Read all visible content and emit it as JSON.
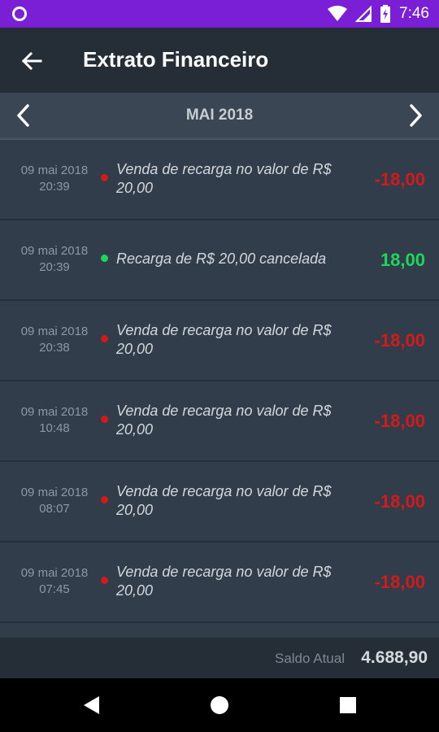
{
  "status_bar": {
    "time": "7:46",
    "icons": [
      "circle-notification-icon",
      "wifi-icon",
      "signal-icon",
      "battery-charging-icon"
    ],
    "color": "#7b1fd6"
  },
  "app_bar": {
    "title": "Extrato Financeiro",
    "back_icon": "arrow-left-icon"
  },
  "month_selector": {
    "label": "MAI 2018",
    "prev_icon": "chevron-left-icon",
    "next_icon": "chevron-right-icon"
  },
  "transactions": [
    {
      "date": "09 mai 2018",
      "time": "20:39",
      "description": "Venda de recarga no valor de R$ 20,00",
      "amount": "-18,00",
      "type": "debit"
    },
    {
      "date": "09 mai 2018",
      "time": "20:39",
      "description": "Recarga de R$ 20,00 cancelada",
      "amount": "18,00",
      "type": "credit"
    },
    {
      "date": "09 mai 2018",
      "time": "20:38",
      "description": "Venda de recarga no valor de R$ 20,00",
      "amount": "-18,00",
      "type": "debit"
    },
    {
      "date": "09 mai 2018",
      "time": "10:48",
      "description": "Venda de recarga no valor de R$ 20,00",
      "amount": "-18,00",
      "type": "debit"
    },
    {
      "date": "09 mai 2018",
      "time": "08:07",
      "description": "Venda de recarga no valor de R$ 20,00",
      "amount": "-18,00",
      "type": "debit"
    },
    {
      "date": "09 mai 2018",
      "time": "07:45",
      "description": "Venda de recarga no valor de R$ 20,00",
      "amount": "-18,00",
      "type": "debit"
    }
  ],
  "colors": {
    "debit": "#d31a1a",
    "credit": "#1ed65a",
    "background": "#313d4a",
    "app_bar": "#252d36"
  },
  "footer": {
    "balance_label": "Saldo Atual",
    "balance_value": "4.688,90"
  },
  "nav_bar": {
    "icons": [
      "back-triangle-icon",
      "home-circle-icon",
      "recents-square-icon"
    ]
  }
}
